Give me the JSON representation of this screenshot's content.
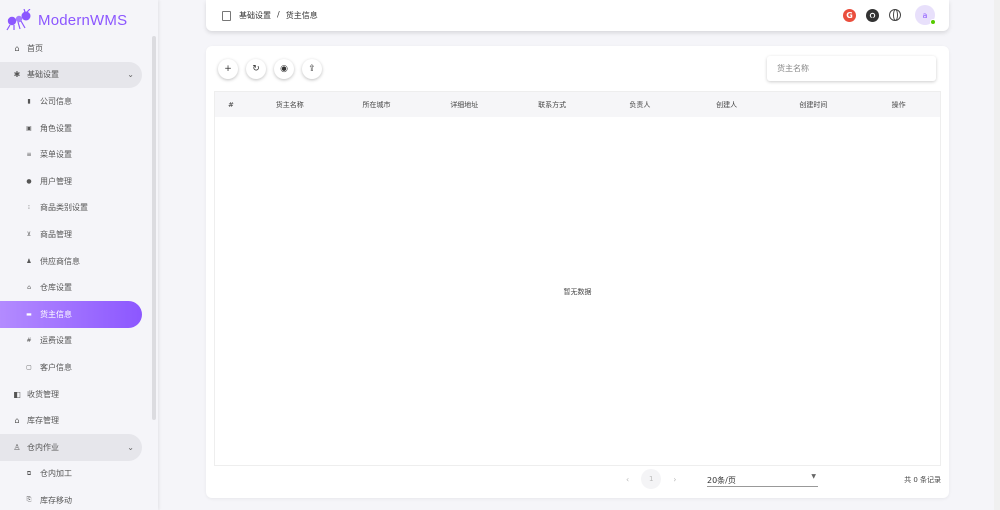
{
  "app": {
    "name": "ModernWMS",
    "brand_color": "#8c57ff"
  },
  "sidebar": {
    "items": [
      {
        "label": "首页",
        "icon": "home-icon",
        "glyph": "⌂",
        "type": "top"
      },
      {
        "label": "基础设置",
        "icon": "gear-icon",
        "glyph": "✱",
        "type": "group-open"
      },
      {
        "label": "公司信息",
        "icon": "building-icon",
        "glyph": "▮",
        "type": "sub"
      },
      {
        "label": "角色设置",
        "icon": "badge-icon",
        "glyph": "▣",
        "type": "sub"
      },
      {
        "label": "菜单设置",
        "icon": "menu-icon",
        "glyph": "≡",
        "type": "sub"
      },
      {
        "label": "用户管理",
        "icon": "user-icon",
        "glyph": "●",
        "type": "sub"
      },
      {
        "label": "商品类别设置",
        "icon": "category-icon",
        "glyph": "⁝",
        "type": "sub"
      },
      {
        "label": "商品管理",
        "icon": "cart-icon",
        "glyph": "⊻",
        "type": "sub"
      },
      {
        "label": "供应商信息",
        "icon": "supplier-icon",
        "glyph": "♟",
        "type": "sub"
      },
      {
        "label": "仓库设置",
        "icon": "warehouse-icon",
        "glyph": "⌂",
        "type": "sub"
      },
      {
        "label": "货主信息",
        "icon": "card-icon",
        "glyph": "▬",
        "type": "active"
      },
      {
        "label": "运费设置",
        "icon": "hash-icon",
        "glyph": "#",
        "type": "sub"
      },
      {
        "label": "客户信息",
        "icon": "contact-icon",
        "glyph": "▢",
        "type": "sub"
      },
      {
        "label": "收货管理",
        "icon": "receiving-icon",
        "glyph": "◧",
        "type": "top"
      },
      {
        "label": "库存管理",
        "icon": "inventory-icon",
        "glyph": "⌂",
        "type": "top"
      },
      {
        "label": "仓内作业",
        "icon": "worker-icon",
        "glyph": "♙",
        "type": "group-open"
      },
      {
        "label": "仓内加工",
        "icon": "process-icon",
        "glyph": "⧉",
        "type": "sub"
      },
      {
        "label": "库存移动",
        "icon": "move-icon",
        "glyph": "⎘",
        "type": "sub"
      }
    ]
  },
  "header": {
    "breadcrumb": [
      "基础设置",
      "货主信息"
    ],
    "separator": "/",
    "avatar_letter": "a",
    "google_letter": "G"
  },
  "toolbar": {
    "add": "+",
    "refresh": "↻",
    "database": "◉",
    "export": "⇪"
  },
  "search": {
    "placeholder": "货主名称"
  },
  "table": {
    "columns": [
      "#",
      "货主名称",
      "所在城市",
      "详细地址",
      "联系方式",
      "负责人",
      "创建人",
      "创建时间",
      "操作"
    ],
    "rows": [],
    "empty_text": "暂无数据"
  },
  "pagination": {
    "prev": "‹",
    "current": "1",
    "next": "›",
    "per_page": "20条/页",
    "total": "共 0 条记录"
  }
}
